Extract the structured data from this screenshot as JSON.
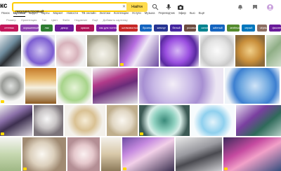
{
  "brand": {
    "logo_text": "кс"
  },
  "search": {
    "value": "перламутровый",
    "find_label": "Найти"
  },
  "nav": {
    "items": [
      "Поиск",
      "Картинки",
      "Видео",
      "Карты",
      "Маркет",
      "Новости",
      "ТВ онлайн",
      "Знатоки",
      "Коллекции",
      "Услуги",
      "Музыка",
      "Переводчик",
      "Эфир",
      "Кью",
      "Ещё"
    ],
    "active_index": 1
  },
  "subnav": {
    "items": [
      "Размер",
      "Ориентация",
      "Тип",
      "Цвет",
      "Файл",
      "Недавние",
      "Ещё",
      "Добавить картинку"
    ]
  },
  "chips": [
    {
      "label": "оттенок",
      "color": "#c2185b"
    },
    {
      "label": "окрашенный",
      "color": "#8e44ad"
    },
    {
      "label": "лак",
      "color": "#2e7d32"
    },
    {
      "label": "декор",
      "color": "#6a1b9a"
    },
    {
      "label": "краска",
      "color": "#ad1457"
    },
    {
      "label": "лак для ногтей",
      "color": "#7b1fa2"
    },
    {
      "label": "шелковистый",
      "color": "#c62828"
    },
    {
      "label": "бусины",
      "color": "#1565c0"
    },
    {
      "label": "жемчуг",
      "color": "#283593"
    },
    {
      "label": "белый",
      "color": "#4527a0"
    },
    {
      "label": "розовый",
      "color": "#6d4c41"
    },
    {
      "label": "синий",
      "color": "#00838f"
    },
    {
      "label": "жёлтый",
      "color": "#1565c0"
    },
    {
      "label": "зелёный",
      "color": "#558b2f"
    },
    {
      "label": "серый",
      "color": "#0277bd"
    },
    {
      "label": "чёрный",
      "color": "#8d6e63"
    },
    {
      "label": "фиолетовый",
      "color": "#6a1b9a"
    }
  ],
  "rows": [
    [
      {
        "w": 30,
        "bg": "linear-gradient(135deg,#e8ecef,#6d8a9c 40%,#2b2f33 60%,#c9d3da)",
        "badge": false
      },
      {
        "w": 46,
        "bg": "radial-gradient(circle at 55% 50%,#cfc2f2,#7c5dd1 55%,#eaeaf2 75%)",
        "badge": false
      },
      {
        "w": 42,
        "bg": "radial-gradient(circle at 40% 55%,#f7e3e6,#d7b2bb 40%,#f1f1f1 70%)",
        "badge": false
      },
      {
        "w": 44,
        "bg": "radial-gradient(circle at 50% 60%,#f5f4ec,#d6d3c4 45%,#9e9a86 75%)",
        "badge": false
      },
      {
        "w": 56,
        "bg": "linear-gradient(120deg,#3a2a5e,#b66ce0 35%,#f0e8f6 55%,#6b4aa0)",
        "badge": true
      },
      {
        "w": 55,
        "bg": "radial-gradient(circle at 45% 50%,#d7b8f5,#9a4fe0 45%,#5a2aa0 70%,#e8e0f0)",
        "badge": false
      },
      {
        "w": 48,
        "bg": "radial-gradient(circle at 50% 50%,#fbfbfb,#e4e4e4 45%,#c9c9c9 70%,#f4f4f4)",
        "badge": false
      },
      {
        "w": 42,
        "bg": "radial-gradient(circle at 50% 50%,#f1d08a,#c98f3b 50%,#8c6a3a 80%)",
        "badge": false
      },
      {
        "w": 32,
        "bg": "linear-gradient(135deg,#dfe7d9,#8fae86 40%,#e8efe3)",
        "badge": false
      }
    ],
    [
      {
        "w": 34,
        "bg": "radial-gradient(circle at 45% 50%,#e0e2e0,#9a9c98 40%,#f6f6f4 70%)",
        "badge": true
      },
      {
        "w": 44,
        "bg": "linear-gradient(180deg,#c47a2a,#e8b86b 30%,#f5f0e0 55%,#8c5a20)",
        "badge": false
      },
      {
        "w": 48,
        "bg": "radial-gradient(circle at 50% 55%,#e6f4d8,#a8d48b 50%,#f3f3ef 75%)",
        "badge": false
      },
      {
        "w": 64,
        "bg": "linear-gradient(160deg,#f2f2f4,#b13a8a 35%,#6a2c7a 55%,#e4e4e8)",
        "badge": false
      },
      {
        "w": 120,
        "bg": "radial-gradient(circle at 40% 45%,#f3eef7,#c8b8e6 35%,#a78fd2 55%,#ece6f3 80%)",
        "badge": false
      },
      {
        "w": 78,
        "bg": "radial-gradient(circle at 55% 50%,#cfe3f7,#6fa8e0 40%,#3c7fd0 60%,#eef3f8 85%)",
        "badge": false
      }
    ],
    [
      {
        "w": 46,
        "bg": "linear-gradient(150deg,#f2f2f2,#8a6fa8 35%,#3e3050 55%,#d9d4df)",
        "badge": true
      },
      {
        "w": 42,
        "bg": "radial-gradient(circle at 45% 45%,#f7f7f7,#c9c5c6 40%,#7b7379 70%)",
        "badge": false
      },
      {
        "w": 58,
        "bg": "radial-gradient(circle at 50% 50%,#f6ecd6,#d9c193 40%,#f3f0ea 70%)",
        "badge": false
      },
      {
        "w": 44,
        "bg": "radial-gradient(circle at 50% 50%,#faf7f0,#e1d7c4 45%,#bfae8c 70%)",
        "badge": false
      },
      {
        "w": 72,
        "bg": "radial-gradient(circle at 50% 50%,#3a8a7a,#8fd1c0 35%,#d8eee8 55%,#3c5a55 80%)",
        "badge": true
      },
      {
        "w": 62,
        "bg": "radial-gradient(circle at 50% 55%,#e3f3fb,#8fd0ee 40%,#f6fbfd 70%)",
        "badge": false
      },
      {
        "w": 74,
        "bg": "linear-gradient(140deg,#e7dff0,#7a3fa0 35%,#2f6a5a 60%,#d6e6e0)",
        "badge": false
      }
    ],
    [
      {
        "w": 30,
        "bg": "linear-gradient(180deg,#f4f4f2,#c6d8b0 50%,#9fb885)",
        "badge": false
      },
      {
        "w": 62,
        "bg": "radial-gradient(circle at 45% 50%,#fbf8f2,#dcd0bd 40%,#a08a72 70%)",
        "badge": true
      },
      {
        "w": 46,
        "bg": "radial-gradient(circle at 50% 50%,#faf1f1,#e6c9cd 40%,#b48f95 70%)",
        "badge": false
      },
      {
        "w": 28,
        "bg": "linear-gradient(180deg,#f3f0ea,#d8c8a8 50%,#8c7a5a)",
        "badge": false
      },
      {
        "w": 74,
        "bg": "linear-gradient(150deg,#6a4aa0,#c68ae0 30%,#f2d0e8 50%,#3a3050)",
        "badge": true
      },
      {
        "w": 66,
        "bg": "linear-gradient(160deg,#eaeaea,#9a9aa0 40%,#4a4a50 60%,#d0d0d4)",
        "badge": false
      },
      {
        "w": 86,
        "bg": "linear-gradient(150deg,#3a2a5a,#c54aa0 35%,#f2a0c8 55%,#2a4a7a)",
        "badge": true
      }
    ]
  ]
}
